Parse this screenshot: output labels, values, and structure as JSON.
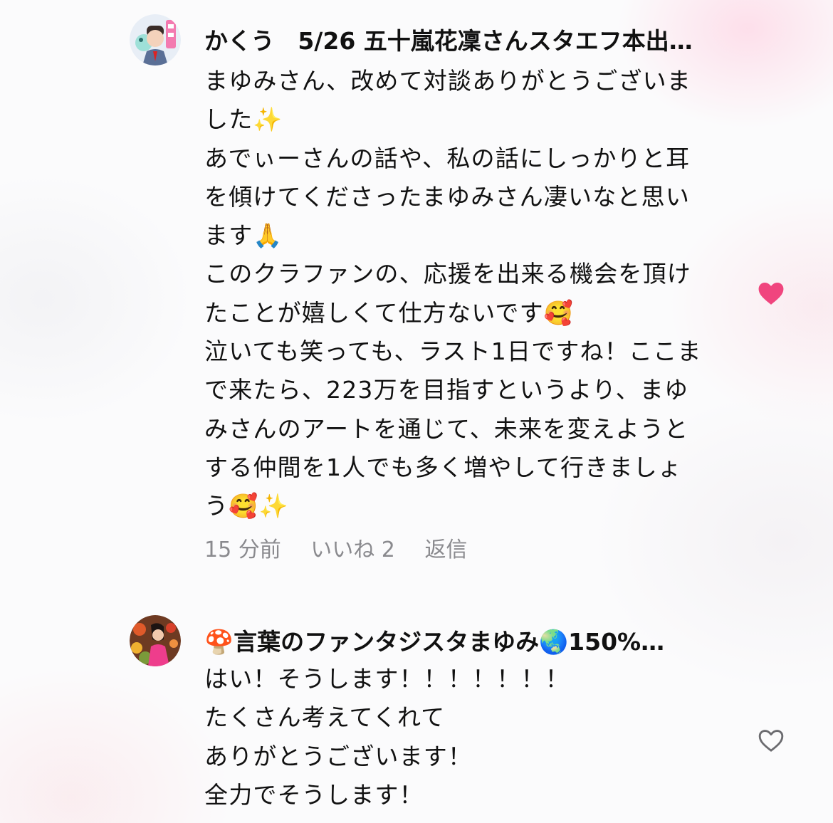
{
  "comments": [
    {
      "username": "かくう　5/26 五十嵐花凜さんスタエフ本出…",
      "lines": [
        "まゆみさん、改めて対談ありがとうございま",
        "した✨",
        "あでぃーさんの話や、私の話にしっかりと耳",
        "を傾けてくださったまゆみさん凄いなと思い",
        "ます🙏",
        "このクラファンの、応援を出来る機会を頂け",
        "たことが嬉しくて仕方ないです🥰",
        "泣いても笑っても、ラスト1日ですね！ここま",
        "で来たら、223万を目指すというより、まゆ",
        "みさんのアートを通じて、未来を変えようと",
        "する仲間を1人でも多く増やして行きましょ",
        "う🥰✨"
      ],
      "time": "15 分前",
      "likes": "いいね 2",
      "reply": "返信",
      "liked": true,
      "like_icon": "heart-filled-icon",
      "like_color": "#f0457e"
    },
    {
      "username": "🍄言葉のファンタジスタまゆみ🌏150%…",
      "lines": [
        "はい！そうします！！！！！！！",
        "たくさん考えてくれて",
        "ありがとうございます！",
        "全力でそうします！"
      ],
      "liked": false,
      "like_icon": "heart-outline-icon",
      "like_color": "#6b6b6f"
    }
  ]
}
